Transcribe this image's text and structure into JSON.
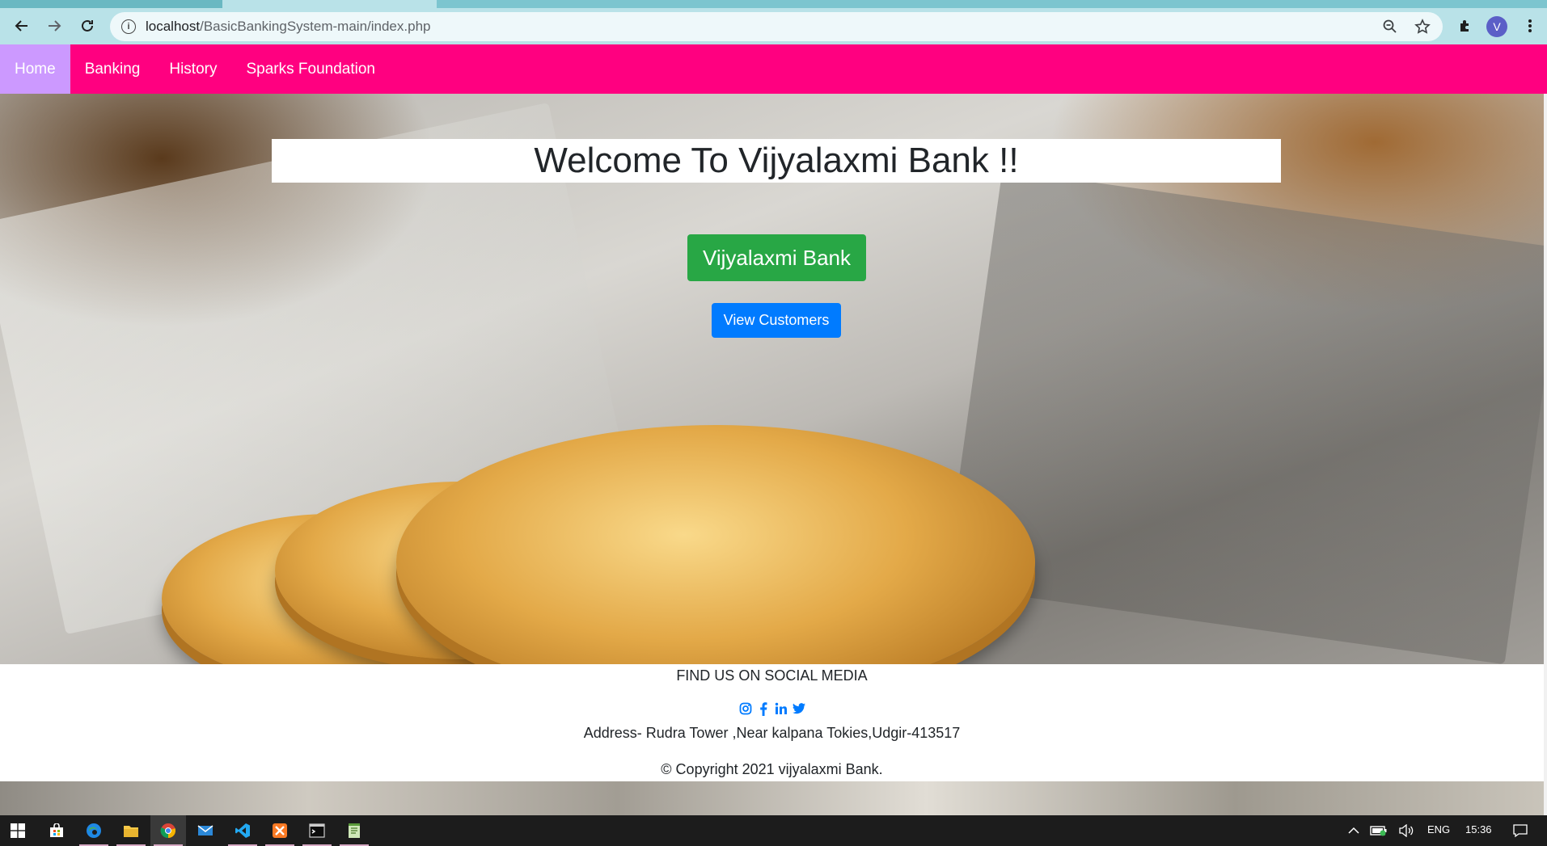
{
  "browser": {
    "url_host": "localhost",
    "url_path": "/BasicBankingSystem-main/index.php",
    "profile_initial": "V",
    "icons": [
      "back-arrow-icon",
      "forward-arrow-icon",
      "reload-icon",
      "info-icon",
      "zoom-icon",
      "star-icon",
      "extensions-icon",
      "menu-dots-icon"
    ]
  },
  "navbar": {
    "items": [
      {
        "label": "Home",
        "active": true
      },
      {
        "label": "Banking",
        "active": false
      },
      {
        "label": "History",
        "active": false
      },
      {
        "label": "Sparks Foundation",
        "active": false
      }
    ],
    "color": "#ff0080",
    "active_color": "#cc99ff"
  },
  "hero": {
    "welcome": "Welcome To Vijyalaxmi Bank !!",
    "bank_name": "Vijyalaxmi Bank",
    "view_customers": "View Customers"
  },
  "footer": {
    "social_title": "FIND US ON SOCIAL MEDIA",
    "social_icons": [
      "instagram-icon",
      "facebook-icon",
      "linkedin-icon",
      "twitter-icon"
    ],
    "address": "Address- Rudra Tower ,Near kalpana Tokies,Udgir-413517",
    "copyright": "© Copyright 2021 vijyalaxmi Bank."
  },
  "taskbar": {
    "apps": [
      "windows-start-icon",
      "store-icon",
      "edge-icon",
      "file-explorer-icon",
      "chrome-icon",
      "mail-icon",
      "vscode-icon",
      "xampp-icon",
      "terminal-icon",
      "notepad-icon"
    ],
    "language": "ENG",
    "time": "15:36"
  }
}
